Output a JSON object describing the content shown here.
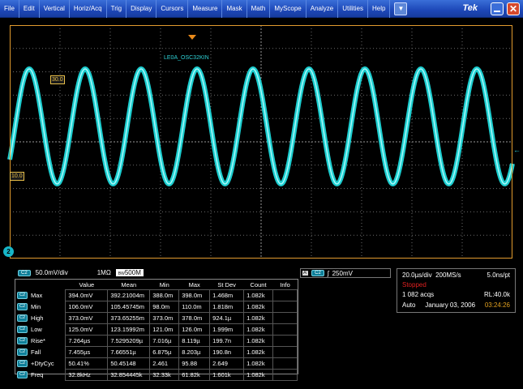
{
  "menu": [
    "File",
    "Edit",
    "Vertical",
    "Horiz/Acq",
    "Trig",
    "Display",
    "Cursors",
    "Measure",
    "Mask",
    "Math",
    "MyScope",
    "Analyze",
    "Utilities",
    "Help"
  ],
  "menu_dropdown": "▼",
  "brand": "Tek",
  "close_glyph": "✕",
  "waveform_label": "LE0A_OSC32KIN",
  "ref_upper": "30.0",
  "ref_lower": "10.0",
  "channel_marker": "2",
  "trig_arrow": "←",
  "channel_settings": {
    "tag": "C2",
    "scale": "50.0mV/div",
    "impedance": "1MΩ",
    "bandwidth_icon": "BW",
    "bandwidth": "500M"
  },
  "trigger": {
    "a_tag": "A'",
    "tag": "C2",
    "slope_glyph": "ʃ",
    "level": "250mV"
  },
  "acquisition": {
    "timebase": "20.0µs/div",
    "sample_rate": "200MS/s",
    "resolution": "5.0ns/pt",
    "state": "Stopped",
    "acqs": "1 082 acqs",
    "record_length": "RL:40.0k",
    "mode": "Auto",
    "date": "January 03, 2006",
    "time": "03:24:26"
  },
  "measurements": {
    "headers": [
      "",
      "Value",
      "Mean",
      "Min",
      "Max",
      "St Dev",
      "Count",
      "Info"
    ],
    "rows": [
      {
        "tag": "C2",
        "name": "Max",
        "value": "394.0mV",
        "mean": "392.21004m",
        "min": "388.0m",
        "max": "398.0m",
        "stdev": "1.468m",
        "count": "1.082k"
      },
      {
        "tag": "C2",
        "name": "Min",
        "value": "106.0mV",
        "mean": "105.45745m",
        "min": "98.0m",
        "max": "110.0m",
        "stdev": "1.818m",
        "count": "1.082k"
      },
      {
        "tag": "C2",
        "name": "High",
        "value": "373.0mV",
        "mean": "373.65255m",
        "min": "373.0m",
        "max": "378.0m",
        "stdev": "924.1µ",
        "count": "1.082k"
      },
      {
        "tag": "C2",
        "name": "Low",
        "value": "125.0mV",
        "mean": "123.15992m",
        "min": "121.0m",
        "max": "126.0m",
        "stdev": "1.999m",
        "count": "1.082k"
      },
      {
        "tag": "C2",
        "name": "Rise*",
        "value": "7.264µs",
        "mean": "7.5295209µ",
        "min": "7.016µ",
        "max": "8.119µ",
        "stdev": "199.7n",
        "count": "1.082k"
      },
      {
        "tag": "C2",
        "name": "Fall",
        "value": "7.455µs",
        "mean": "7.66551µ",
        "min": "6.875µ",
        "max": "8.203µ",
        "stdev": "190.8n",
        "count": "1.082k"
      },
      {
        "tag": "C2",
        "name": "+DtyCyc",
        "value": "50.41%",
        "mean": "50.45148",
        "min": "2.461",
        "max": "95.88",
        "stdev": "2.649",
        "count": "1.082k"
      },
      {
        "tag": "C2",
        "name": "Freq",
        "value": "32.8kHz",
        "mean": "32.854445k",
        "min": "32.33k",
        "max": "61.82k",
        "stdev": "1.601k",
        "count": "1.082k"
      }
    ]
  },
  "colors": {
    "trace": "#1fe3e6",
    "frame": "#e19b2e",
    "grid": "#6b6b6b",
    "menubar": "#1d47b8"
  }
}
